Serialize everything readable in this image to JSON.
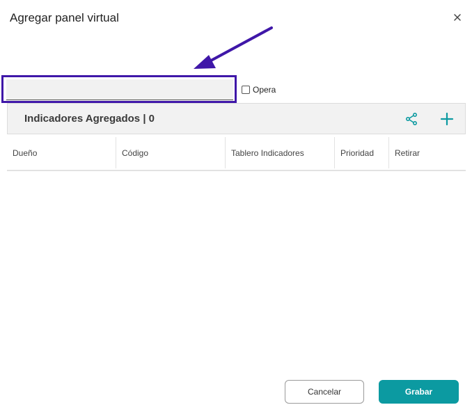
{
  "dialog": {
    "title": "Agregar panel virtual",
    "close_icon": "close-icon"
  },
  "annotation": {
    "arrow_color": "#3f17a8",
    "highlight_color": "#3f17a8"
  },
  "form": {
    "name_value": "",
    "opera_label": "Opera",
    "opera_checked": false
  },
  "panel": {
    "title": "Indicadores Agregados | 0",
    "share_icon": "share-icon",
    "add_icon": "plus-icon",
    "accent": "#0c9aa1"
  },
  "table": {
    "columns": [
      "Dueño",
      "Código",
      "Tablero Indicadores",
      "Prioridad",
      "Retirar"
    ],
    "rows": []
  },
  "footer": {
    "cancel_label": "Cancelar",
    "save_label": "Grabar"
  }
}
